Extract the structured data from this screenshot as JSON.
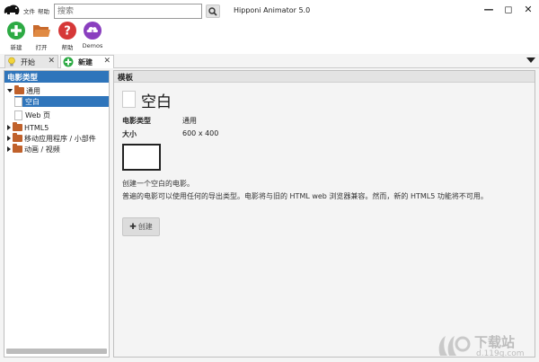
{
  "app": {
    "title": "Hipponi Animator 5.0"
  },
  "menu": {
    "file": "文件",
    "help": "帮助"
  },
  "search": {
    "placeholder": "搜索"
  },
  "window_controls": {
    "minimize": "—",
    "maximize": "◻",
    "close": "✕"
  },
  "toolbar": {
    "new_label": "新建",
    "open_label": "打开",
    "help_label": "帮助",
    "demos_label": "Demos",
    "colors": {
      "new": "#2daa44",
      "open": "#c86a2c",
      "help": "#d63838",
      "demos": "#8a3fbf"
    }
  },
  "tabs": [
    {
      "label": "开始",
      "icon": "lightbulb-icon"
    },
    {
      "label": "新建",
      "icon": "plus-circle-icon"
    }
  ],
  "left_panel": {
    "header": "电影类型",
    "tree": {
      "general": "通用",
      "blank": "空白",
      "web": "Web 页",
      "html5": "HTML5",
      "mobile": "移动应用程序 / 小部件",
      "animation": "动画 / 视频"
    }
  },
  "main_panel": {
    "header": "模板",
    "template_name": "空白",
    "type_key": "电影类型",
    "type_val": "通用",
    "size_key": "大小",
    "size_val": "600 x 400",
    "desc1": "创建一个空白的电影。",
    "desc2": "普遍的电影可以使用任何的导出类型。电影将与旧的 HTML web 浏览器兼容。然而，新的 HTML5 功能将不可用。",
    "create_label": "创建"
  },
  "watermark": {
    "text": "下载站",
    "url": "d.119g.com"
  },
  "colors": {
    "accent": "#2f75bb"
  }
}
